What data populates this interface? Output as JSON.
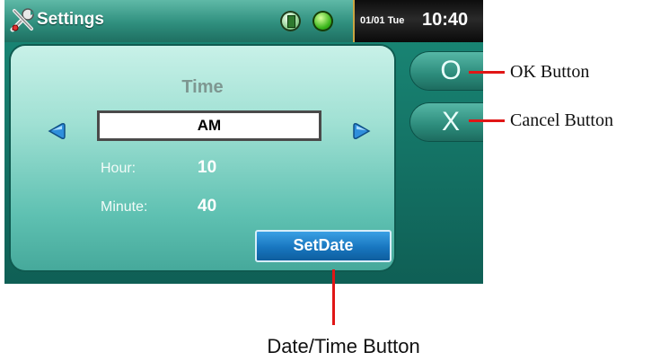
{
  "titlebar": {
    "title": "Settings",
    "date": "01/01 Tue",
    "time": "10:40",
    "icons": [
      "tools-icon",
      "battery-icon",
      "gps-icon"
    ]
  },
  "panel": {
    "title": "Time",
    "ampm_value": "AM",
    "hour_label": "Hour:",
    "hour_value": "10",
    "minute_label": "Minute:",
    "minute_value": "40",
    "setdate_label": "SetDate"
  },
  "side_buttons": {
    "ok_symbol": "O",
    "cancel_symbol": "X"
  },
  "callouts": {
    "ok": "OK Button",
    "cancel": "Cancel Button",
    "datetime": "Date/Time Button"
  },
  "colors": {
    "accent": "#1876bf",
    "teal": "#2f8f7e",
    "callout_line": "#e01616"
  }
}
